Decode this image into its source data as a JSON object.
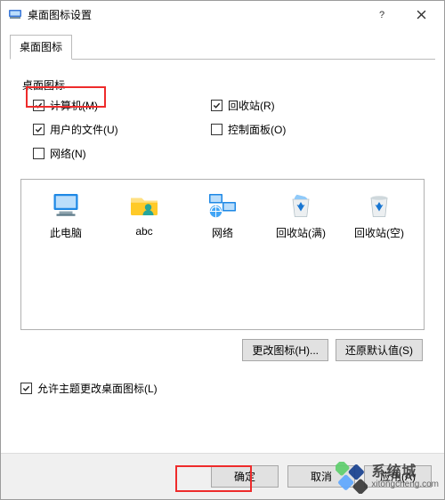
{
  "window": {
    "title": "桌面图标设置"
  },
  "tab": {
    "label": "桌面图标"
  },
  "group": {
    "label": "桌面图标"
  },
  "checks": {
    "computer": {
      "label": "计算机(M)",
      "checked": true
    },
    "recycle": {
      "label": "回收站(R)",
      "checked": true
    },
    "userfiles": {
      "label": "用户的文件(U)",
      "checked": true
    },
    "control": {
      "label": "控制面板(O)",
      "checked": false
    },
    "network": {
      "label": "网络(N)",
      "checked": false
    }
  },
  "icons": {
    "thispc": {
      "label": "此电脑"
    },
    "user": {
      "label": "abc"
    },
    "network": {
      "label": "网络"
    },
    "recyclefull": {
      "label": "回收站(满)"
    },
    "recycleempty": {
      "label": "回收站(空)"
    }
  },
  "buttons": {
    "changeicon": "更改图标(H)...",
    "restore": "还原默认值(S)",
    "ok": "确定",
    "cancel": "取消",
    "apply": "应用(A)"
  },
  "allowThemes": {
    "label": "允许主题更改桌面图标(L)",
    "checked": true
  },
  "watermark": {
    "cn": "系统城",
    "url": "xitongcheng.com"
  }
}
